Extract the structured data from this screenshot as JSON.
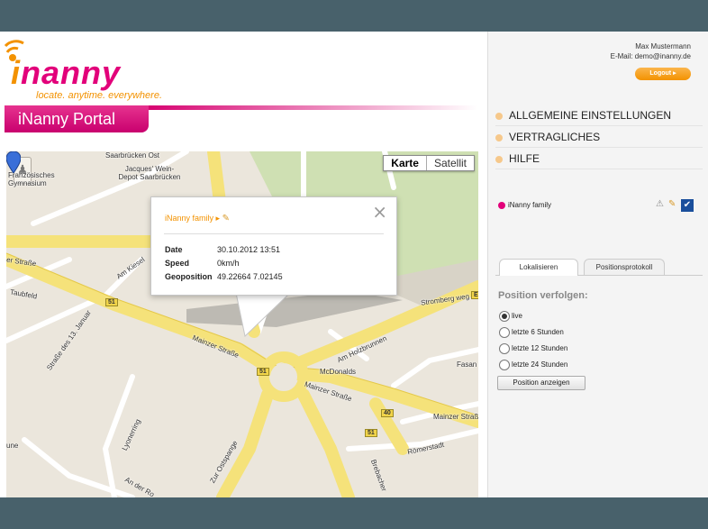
{
  "header": {
    "logo_text": "nanny",
    "logo_i": "i",
    "tagline": "locate. anytime. everywhere.",
    "portal_title": "iNanny Portal"
  },
  "map": {
    "type_buttons": [
      "Karte",
      "Satellit"
    ],
    "labels": {
      "saarbrucken": "Saarbrücken Ost",
      "jacques": "Jacques' Wein-Depot Saarbrücken",
      "gymnasium": "Französisches Gymnasium",
      "strasse_left": "er Straße",
      "am_kiesel": "Am Kiesel",
      "taubfeld": "Taubfeld",
      "strasse13": "Straße des 13. Januar",
      "mainzer1": "Mainzer Straße",
      "mainzer2": "Mainzer Straße",
      "mainzer3": "Mainzer Straße",
      "am_holzbrunnen": "Am Holzbrunnen",
      "mcdonalds": "McDonalds",
      "lyonerring": "Lyonerring",
      "zur_ostspange": "Zur Ostspange",
      "brebacher": "Brebacher",
      "romerstadt": "Römerstadt",
      "an_der": "An der Ro",
      "fasan": "Fasan",
      "stromberg": "Stromberg weg",
      "une": "une"
    },
    "shields": [
      "51",
      "51",
      "51",
      "40",
      "51",
      "E"
    ],
    "info": {
      "title": "iNanny family ▸",
      "date_label": "Date",
      "date_value": "30.10.2012 13:51",
      "speed_label": "Speed",
      "speed_value": "0km/h",
      "geo_label": "Geoposition",
      "geo_value": "49.22664 7.02145"
    }
  },
  "panel": {
    "user_name": "Max Mustermann",
    "user_email": "E-Mail: demo@inanny.de",
    "logout": "Logout",
    "nav": [
      "ALLGEMEINE EINSTELLUNGEN",
      "VERTRAGLICHES",
      "HILFE"
    ],
    "family": "iNanny family",
    "tabs": [
      "Lokalisieren",
      "Positionsprotokoll"
    ],
    "track_title": "Position verfolgen:",
    "options": [
      "live",
      "letzte 6 Stunden",
      "letzte 12 Stunden",
      "letzte 24 Stunden"
    ],
    "selected_option": "live",
    "show_button": "Position anzeigen"
  },
  "colors": {
    "brand_pink": "#e2007a",
    "brand_orange": "#f39200",
    "road_yellow": "#f5e27a",
    "map_bg": "#ebe6dc",
    "outer_bg": "#48616b"
  }
}
